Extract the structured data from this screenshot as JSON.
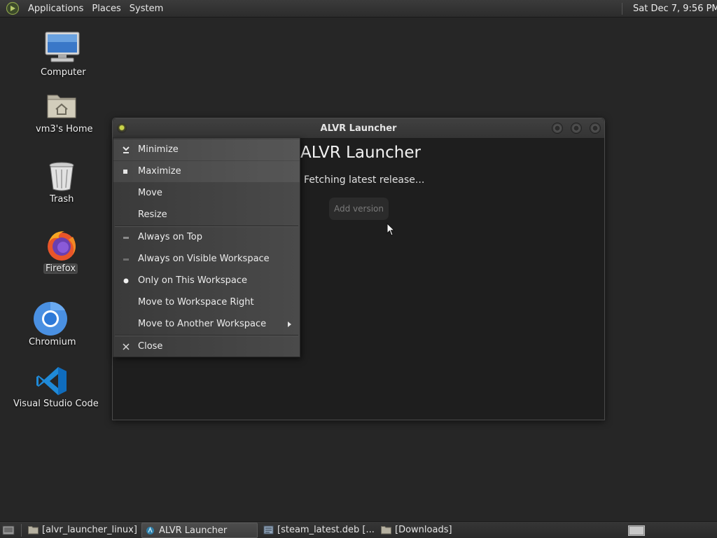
{
  "top_panel": {
    "menus": [
      "Applications",
      "Places",
      "System"
    ],
    "clock": "Sat Dec  7,  9:56 PM"
  },
  "desktop": {
    "icons": [
      {
        "label": "Computer",
        "icon": "computer-icon"
      },
      {
        "label": "vm3's Home",
        "icon": "home-folder-icon"
      },
      {
        "label": "Trash",
        "icon": "trash-icon"
      },
      {
        "label": "Firefox",
        "icon": "firefox-icon"
      },
      {
        "label": "Chromium",
        "icon": "chromium-icon"
      },
      {
        "label": "Visual Studio Code",
        "icon": "vscode-icon"
      }
    ]
  },
  "window": {
    "title": "ALVR Launcher",
    "heading": "ALVR Launcher",
    "status": "Fetching latest release...",
    "add_version_label": "Add version"
  },
  "context_menu": {
    "items": [
      {
        "label": "Minimize",
        "icon": "minimize-icon"
      },
      {
        "label": "Maximize",
        "icon": "maximize-icon"
      },
      {
        "label": "Move",
        "icon": ""
      },
      {
        "label": "Resize",
        "icon": ""
      },
      {
        "label": "Always on Top",
        "icon": "checkbox-icon"
      },
      {
        "label": "Always on Visible Workspace",
        "icon": "radio-icon"
      },
      {
        "label": "Only on This Workspace",
        "icon": "radio-selected-icon"
      },
      {
        "label": "Move to Workspace Right",
        "icon": ""
      },
      {
        "label": "Move to Another Workspace",
        "icon": "submenu-arrow-icon"
      },
      {
        "label": "Close",
        "icon": "close-icon"
      }
    ]
  },
  "taskbar": {
    "tasks": [
      {
        "label": "[alvr_launcher_linux]",
        "icon": "folder-icon",
        "active": false
      },
      {
        "label": "ALVR Launcher",
        "icon": "alvr-icon",
        "active": true
      },
      {
        "label": "[steam_latest.deb [...",
        "icon": "package-icon",
        "active": false
      },
      {
        "label": "[Downloads]",
        "icon": "folder-icon",
        "active": false
      }
    ]
  }
}
